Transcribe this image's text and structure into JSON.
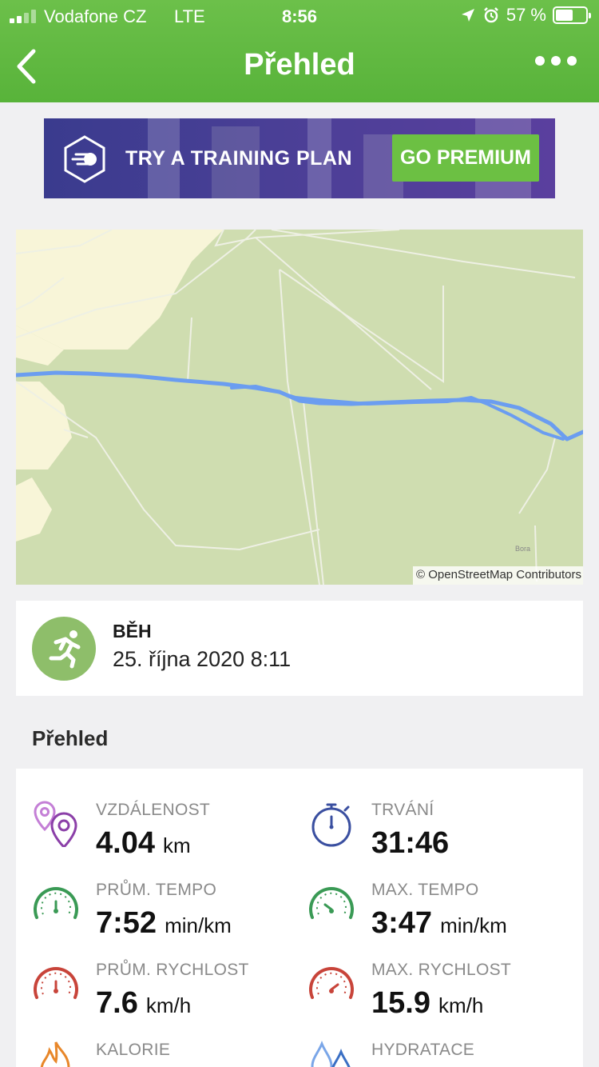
{
  "status_bar": {
    "carrier": "Vodafone CZ",
    "network": "LTE",
    "time": "8:56",
    "battery": "57 %",
    "battery_level": 0.57
  },
  "nav": {
    "title": "Přehled"
  },
  "banner": {
    "text": "TRY A TRAINING PLAN",
    "button": "GO PREMIUM"
  },
  "map": {
    "credit": "© OpenStreetMap Contributors",
    "place_label": "Bora"
  },
  "activity": {
    "type": "BĚH",
    "date": "25. října 2020 8:11"
  },
  "overview": {
    "title": "Přehled",
    "stats": [
      {
        "label": "VZDÁLENOST",
        "value": "4.04",
        "unit": "km",
        "icon": "distance-pin-icon",
        "color": "#8b3fa8"
      },
      {
        "label": "TRVÁNÍ",
        "value": "31:46",
        "unit": "",
        "icon": "stopwatch-icon",
        "color": "#3a4fa0"
      },
      {
        "label": "PRŮM. TEMPO",
        "value": "7:52",
        "unit": "min/km",
        "icon": "avg-pace-gauge-icon",
        "color": "#3a9a55"
      },
      {
        "label": "MAX. TEMPO",
        "value": "3:47",
        "unit": "min/km",
        "icon": "max-pace-gauge-icon",
        "color": "#3a9a55"
      },
      {
        "label": "PRŮM. RYCHLOST",
        "value": "7.6",
        "unit": "km/h",
        "icon": "avg-speed-gauge-icon",
        "color": "#c8443a"
      },
      {
        "label": "MAX. RYCHLOST",
        "value": "15.9",
        "unit": "km/h",
        "icon": "max-speed-gauge-icon",
        "color": "#c8443a"
      },
      {
        "label": "KALORIE",
        "value": "",
        "unit": "",
        "icon": "flame-icon",
        "color": "#e8872a"
      },
      {
        "label": "HYDRATACE",
        "value": "",
        "unit": "",
        "icon": "water-drops-icon",
        "color": "#4a7fd0"
      }
    ]
  }
}
